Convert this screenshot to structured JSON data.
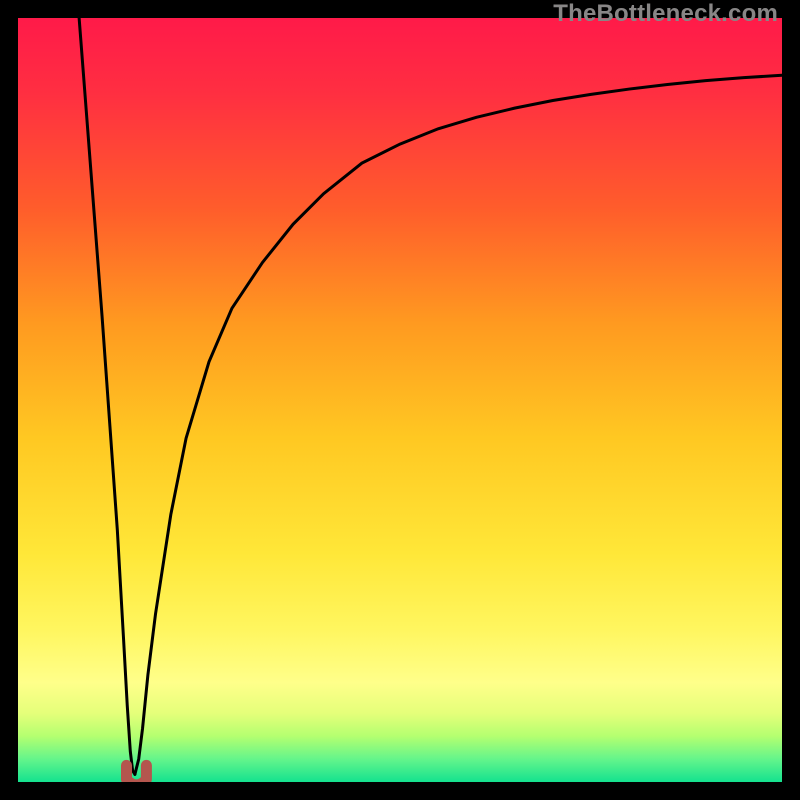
{
  "watermark": "TheBottleneck.com",
  "colors": {
    "frame": "#000000",
    "gradient_stops": [
      {
        "offset": 0.0,
        "color": "#ff1a49"
      },
      {
        "offset": 0.1,
        "color": "#ff2f41"
      },
      {
        "offset": 0.25,
        "color": "#ff5d2b"
      },
      {
        "offset": 0.4,
        "color": "#ff9a20"
      },
      {
        "offset": 0.55,
        "color": "#ffc822"
      },
      {
        "offset": 0.7,
        "color": "#ffe738"
      },
      {
        "offset": 0.8,
        "color": "#fff65f"
      },
      {
        "offset": 0.87,
        "color": "#ffff8a"
      },
      {
        "offset": 0.91,
        "color": "#e5ff7a"
      },
      {
        "offset": 0.94,
        "color": "#b4ff70"
      },
      {
        "offset": 0.97,
        "color": "#64f58b"
      },
      {
        "offset": 1.0,
        "color": "#14e28f"
      }
    ],
    "curve": "#000000",
    "marker_fill": "#b4564e",
    "marker_stroke": "#a04a43"
  },
  "chart_data": {
    "type": "line",
    "title": "",
    "xlabel": "",
    "ylabel": "",
    "xlim": [
      0,
      100
    ],
    "ylim": [
      0,
      100
    ],
    "notes": "Bottleneck percentage curve. Vertical gradient encodes bottleneck: red=high, green=low. Single optimum near x≈15, y≈0.",
    "series": [
      {
        "name": "bottleneck",
        "x": [
          8,
          9,
          10,
          11,
          12,
          13,
          13.8,
          14.3,
          14.7,
          15,
          15.3,
          15.8,
          16.3,
          17,
          18,
          20,
          22,
          25,
          28,
          32,
          36,
          40,
          45,
          50,
          55,
          60,
          65,
          70,
          75,
          80,
          85,
          90,
          95,
          100
        ],
        "y": [
          100,
          87,
          74,
          61,
          47,
          33,
          19,
          10,
          4,
          1.5,
          1,
          3,
          7,
          14,
          22,
          35,
          45,
          55,
          62,
          68,
          73,
          77,
          81,
          83.5,
          85.5,
          87,
          88.2,
          89.2,
          90,
          90.7,
          91.3,
          91.8,
          92.2,
          92.5
        ]
      }
    ],
    "optimum_marker": {
      "x_range": [
        14.2,
        16.8
      ],
      "y": 1
    }
  }
}
